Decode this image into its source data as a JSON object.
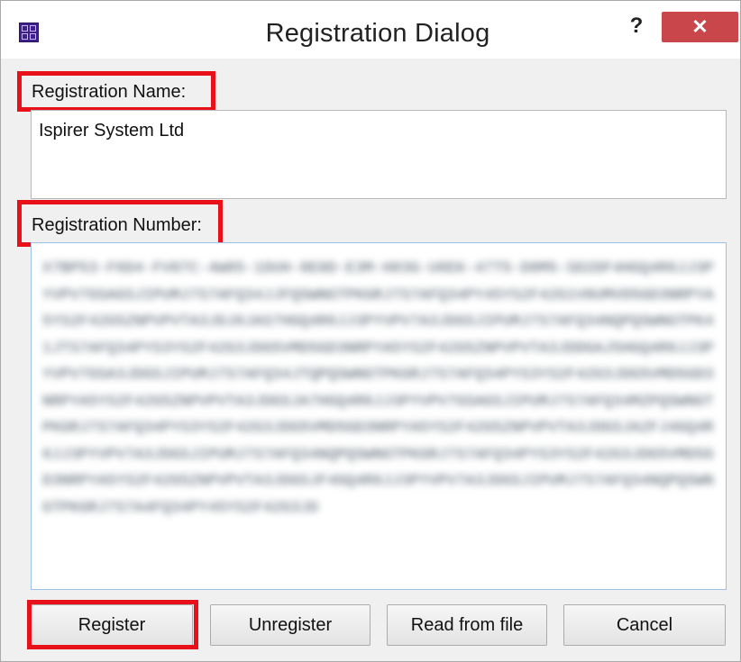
{
  "dialog": {
    "title": "Registration Dialog",
    "help_label": "?",
    "close_label": "✕"
  },
  "form": {
    "name_label": "Registration Name:",
    "name_value": "Ispirer System Ltd",
    "number_label": "Registration Number:",
    "number_value": "X7BP53-F6D4-FV07C-4W85-1DUH-8E0D-E3M-H83G-U6EK-47T5-D8M5-SD2DF4HGQ4R6JJ3PYVPV7GSAGSJIPUMJ7S7AFQ34JJFQSWNGTPKGRJ7S7AFQ34PY45YS2F42G1V0UMVD5GD3NRPYA5YS2F42G5ZNPVPVTA3JDJ6JAS7HGQ4R6JJ3PYVPV7A3JDGSJIPUMJ7S7AFQ34NQPQSWNGTPK41JTS7AFQ34PYS3YS2F42G3JDG5VMD5GD3NRPYA5YS2F42G5ZNPVPVTA3JDDGAJ5HGQ4R6JJ3PYVPV7GSA3JDGSJIPUMJ7S7AFQ34JTQPQSWNGTPKGRJ7S7AFQ34PYS3YS2F42G3JDG5VMD5GD3NRPYA5YS2F42G5ZNPVPVTA3JDGSJA7HGQ4R6JJ3PYVPV7GSAGSJIPUMJ7S7AFQ34MZPQSWNGTPKGRJ7S7AFQ34PYS3YS2F42G3JDG5VMD5GD3NRPYA5YS2F42G5ZNPVPVTA3JDGSJA2FJ4GQ4R6JJ3PYVPV7A3JDGSJIPUMJ7S7AFQ34NQPQSWNGTPKGRJ7S7AFQ34PYS3YS2F42G3JDG5VMD5GD3NRPYA5YS2F42G5ZNPVPVTA3JDGSJF4GQ4R6JJ3PYVPV7A3JDGSJIPUMJ7S7AFQ34NQPQSWNGTPKGRJ7S7A4FQ34PY45YS2F42G3JD"
  },
  "buttons": {
    "register": "Register",
    "unregister": "Unregister",
    "read_from_file": "Read from file",
    "cancel": "Cancel"
  },
  "colors": {
    "highlight": "#e8111a",
    "close_button": "#c9474b",
    "app_icon": "#3f1f8c"
  }
}
